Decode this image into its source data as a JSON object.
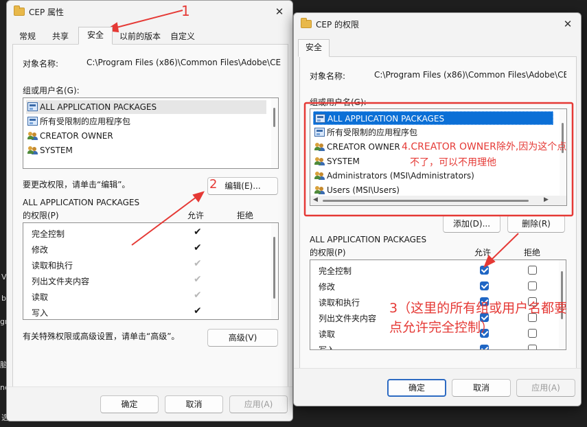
{
  "colors": {
    "accent": "#0b6fd6",
    "annotation": "#e53935",
    "checkbox_on": "#1f66c4"
  },
  "background_strip": [
    "V",
    "b",
    "gr",
    "脑",
    "ne",
    "选"
  ],
  "left_dialog": {
    "title": "CEP 属性",
    "close_icon": "✕",
    "tabs": [
      "常规",
      "共享",
      "安全",
      "以前的版本",
      "自定义"
    ],
    "active_tab": "安全",
    "object_name_label": "对象名称:",
    "object_name_value": "C:\\Program Files (x86)\\Common Files\\Adobe\\CE",
    "group_label": "组或用户名(G):",
    "groups": [
      "ALL APPLICATION PACKAGES",
      "所有受限制的应用程序包",
      "CREATOR OWNER",
      "SYSTEM"
    ],
    "edit_hint": "要更改权限，请单击“编辑”。",
    "edit_button": "编辑(E)...",
    "perm_for": "ALL APPLICATION PACKAGES",
    "perm_label": "的权限(P)",
    "allow_header": "允许",
    "deny_header": "拒绝",
    "permissions": [
      {
        "name": "完全控制",
        "allow": "✔"
      },
      {
        "name": "修改",
        "allow": "✔"
      },
      {
        "name": "读取和执行",
        "allow": "✔"
      },
      {
        "name": "列出文件夹内容",
        "allow": "✔"
      },
      {
        "name": "读取",
        "allow": "✔"
      },
      {
        "name": "写入",
        "allow": "✔"
      }
    ],
    "advanced_hint": "有关特殊权限或高级设置，请单击“高级”。",
    "advanced_button": "高级(V)",
    "ok_button": "确定",
    "cancel_button": "取消",
    "apply_button": "应用(A)"
  },
  "right_dialog": {
    "title": "CEP 的权限",
    "close_icon": "✕",
    "tab": "安全",
    "object_name_label": "对象名称:",
    "object_name_value": "C:\\Program Files (x86)\\Common Files\\Adobe\\CE",
    "group_label": "组或用户名(G):",
    "groups": [
      "ALL APPLICATION PACKAGES",
      "所有受限制的应用程序包",
      "CREATOR OWNER",
      "SYSTEM",
      "Administrators (MSI\\Administrators)",
      "Users (MSI\\Users)"
    ],
    "add_button": "添加(D)...",
    "remove_button": "删除(R)",
    "perm_for": "ALL APPLICATION PACKAGES",
    "perm_label": "的权限(P)",
    "allow_header": "允许",
    "deny_header": "拒绝",
    "permissions": [
      {
        "name": "完全控制",
        "allow": true,
        "deny": false
      },
      {
        "name": "修改",
        "allow": true,
        "deny": false
      },
      {
        "name": "读取和执行",
        "allow": true,
        "deny": false
      },
      {
        "name": "列出文件夹内容",
        "allow": true,
        "deny": false
      },
      {
        "name": "读取",
        "allow": true,
        "deny": false
      },
      {
        "name": "写入",
        "allow": true,
        "deny": false
      }
    ],
    "ok_button": "确定",
    "cancel_button": "取消",
    "apply_button": "应用(A)"
  },
  "annotations": {
    "a1": "1",
    "a2": "2",
    "a3_line1": "3（这里的所有组或用户名都要",
    "a3_line2": "点允许完全控制）",
    "a4_line1": "4.CREATOR OWNER除外,因为这个点",
    "a4_line2": "不了，可以不用理他"
  }
}
